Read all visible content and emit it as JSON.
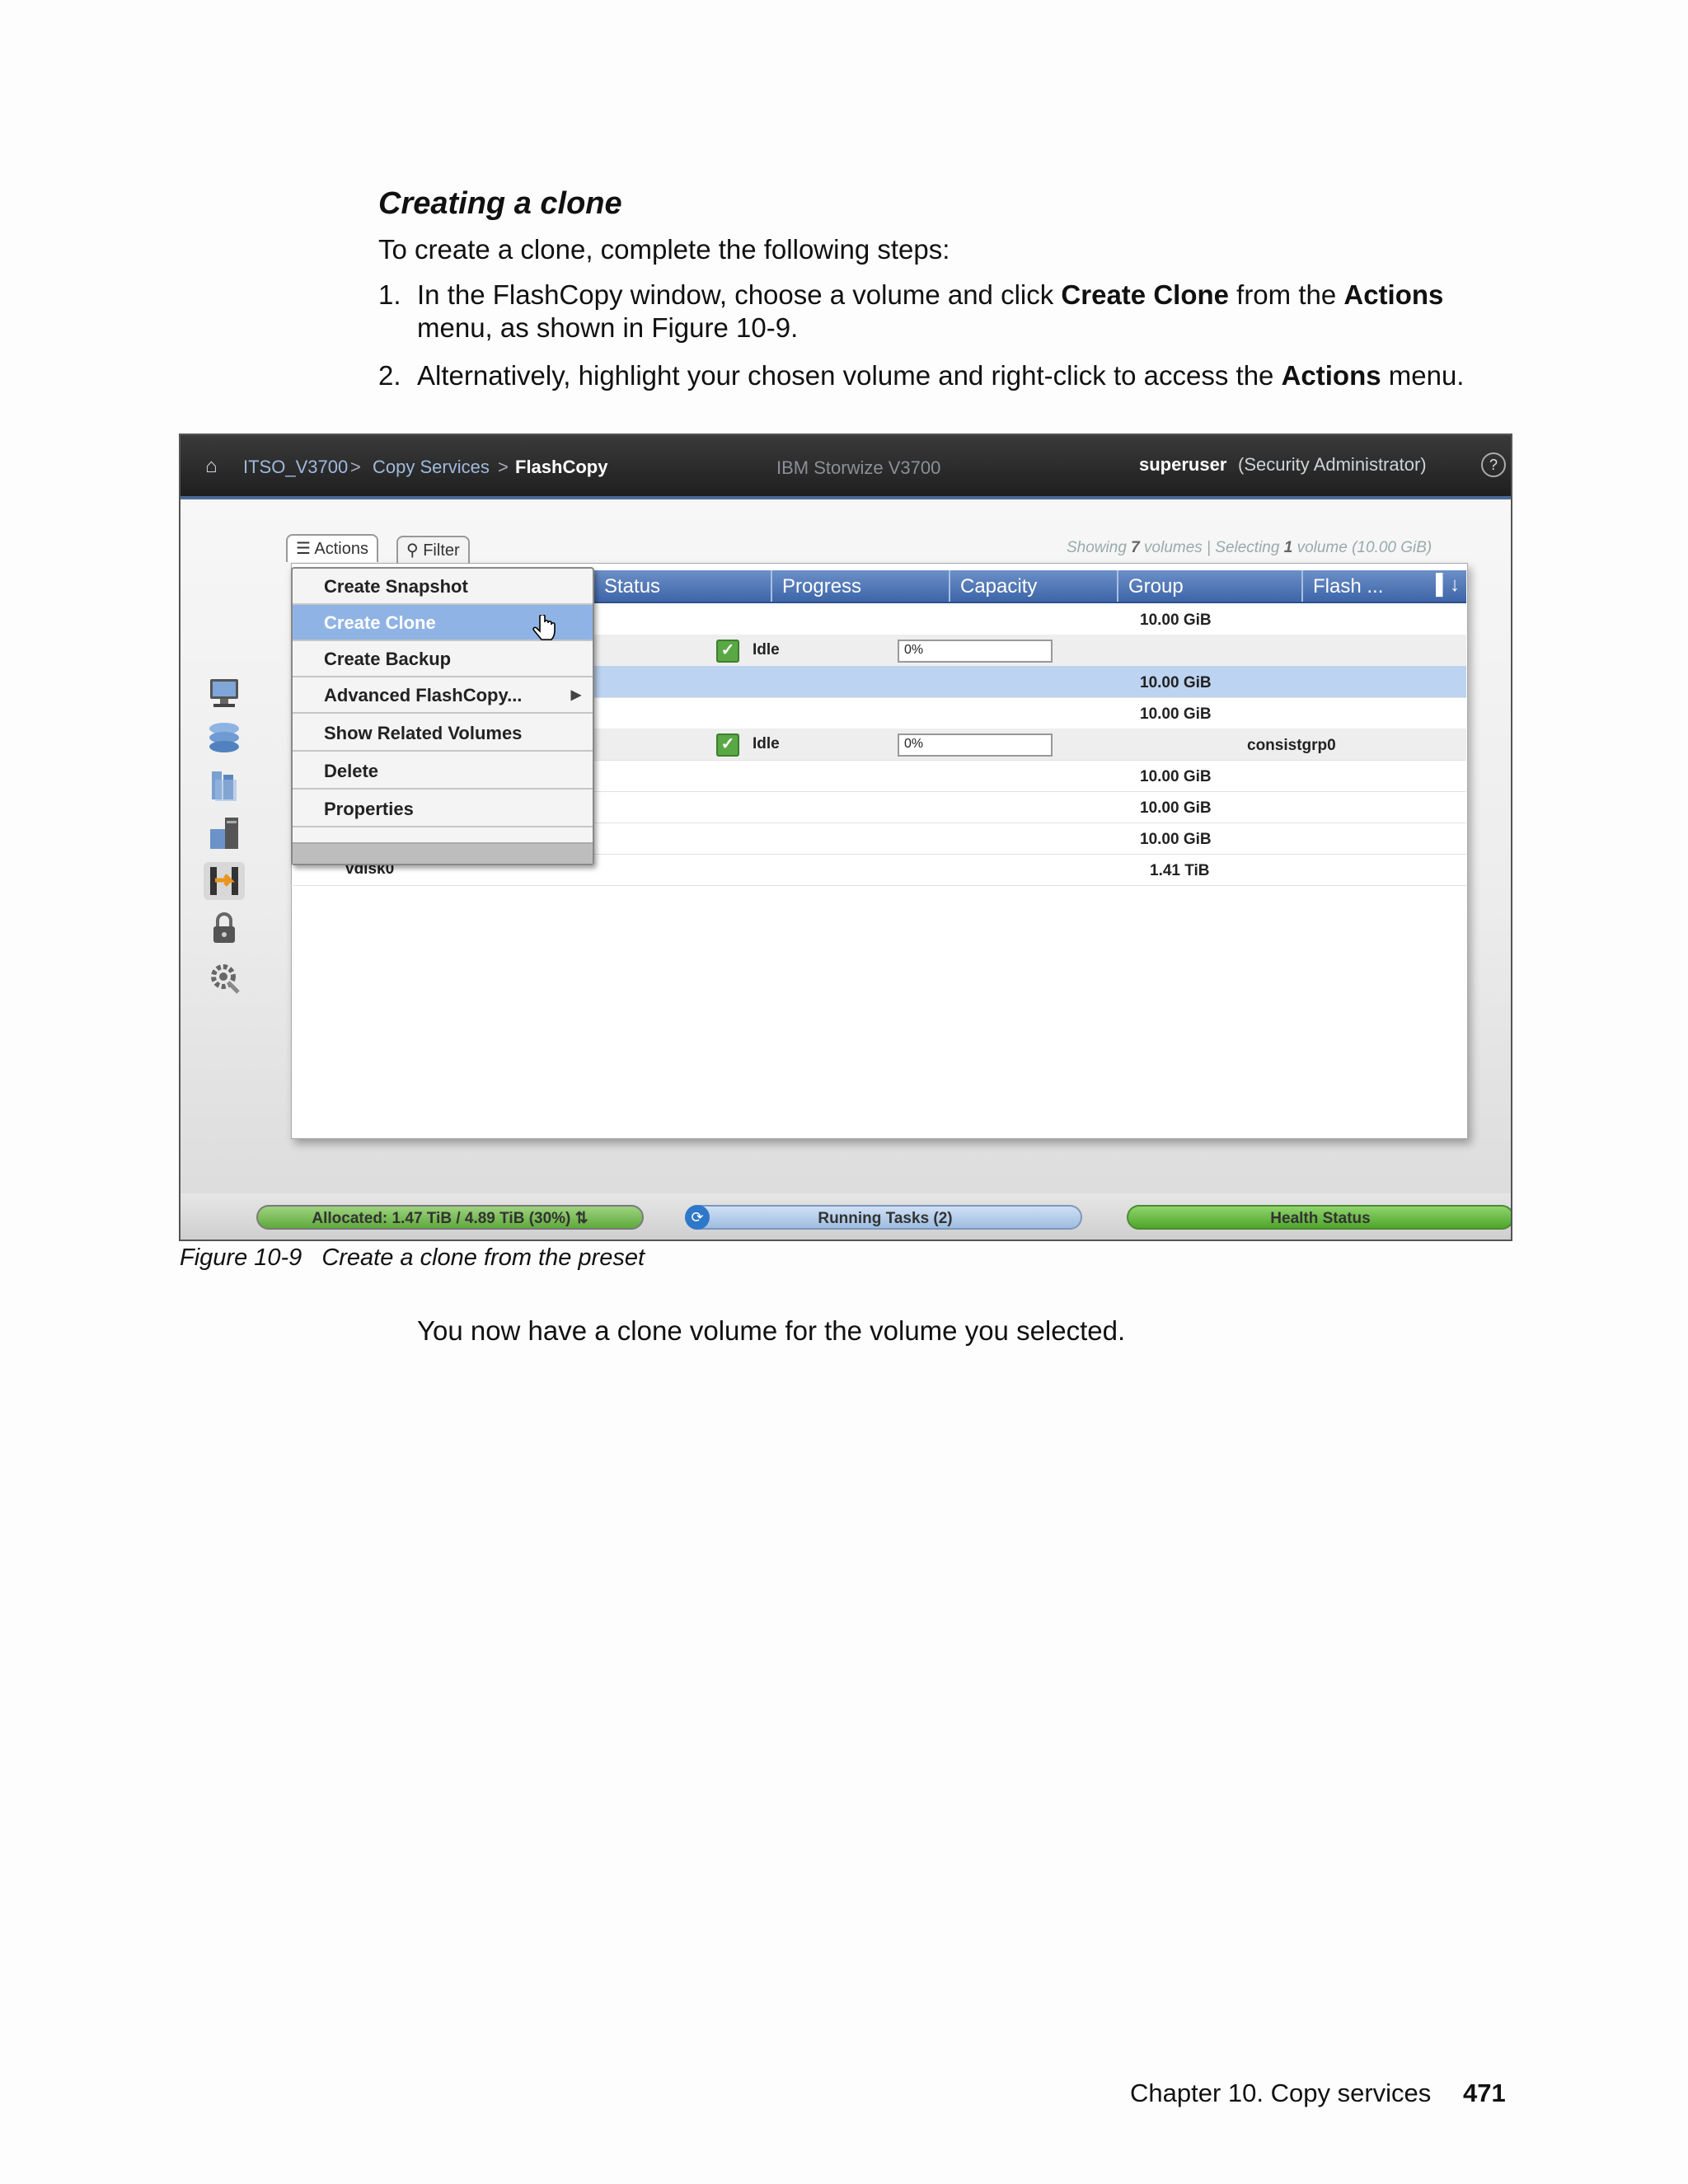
{
  "document": {
    "heading": "Creating a clone",
    "intro": "To create a clone, complete the following steps:",
    "steps": [
      {
        "num": "1.",
        "pre": "In the FlashCopy window, choose a volume and click ",
        "b1": "Create Clone",
        "mid": " from the ",
        "b2": "Actions",
        "post": "",
        "line2": "menu, as shown in Figure 10-9."
      },
      {
        "num": "2.",
        "pre": "Alternatively, highlight your chosen volume and right-click to access the ",
        "b1": "Actions",
        "post": " menu."
      }
    ],
    "figure_number": "Figure 10-9",
    "figure_title": "Create a clone from the preset",
    "after_text": "You now have a clone volume for the volume you selected.",
    "footer_chapter": "Chapter 10. Copy services",
    "footer_page": "471"
  },
  "app": {
    "breadcrumb": [
      "ITSO_V3700",
      "Copy Services",
      "FlashCopy"
    ],
    "product": "IBM Storwize V3700",
    "user": "superuser",
    "role": "(Security Administrator)",
    "help": "?",
    "tabs": {
      "actions": "Actions",
      "filter": "Filter"
    },
    "showing": {
      "pre": "Showing ",
      "n1": "7",
      "mid": " volumes | Selecting ",
      "n2": "1",
      "post": " volume (10.00 GiB)"
    },
    "columns": [
      "Status",
      "Progress",
      "Capacity",
      "Group",
      "Flash ..."
    ],
    "rows": [
      {
        "capacity": "10.00 GiB"
      },
      {
        "status": "Idle",
        "progress": "0%",
        "progress_value": 0
      },
      {
        "capacity": "10.00 GiB",
        "selected": true
      },
      {
        "capacity": "10.00 GiB"
      },
      {
        "status": "Idle",
        "progress": "0%",
        "progress_value": 0,
        "group": "consistgrp0"
      },
      {
        "capacity": "10.00 GiB"
      },
      {
        "capacity": "10.00 GiB"
      },
      {
        "capacity": "10.00 GiB"
      },
      {
        "name": "vdisk0",
        "capacity": "1.41 TiB"
      }
    ],
    "menu": [
      "Create Snapshot",
      "Create Clone",
      "Create Backup",
      "Advanced FlashCopy...",
      "Show Related Volumes",
      "Delete",
      "Properties"
    ],
    "menu_highlighted": "Create Clone",
    "status": {
      "allocated": "Allocated: 1.47 TiB / 4.89 TiB (30%)",
      "tasks": "Running Tasks (2)",
      "health": "Health Status"
    },
    "nav_icons": [
      "monitoring-icon",
      "pools-icon",
      "volumes-icon",
      "hosts-icon",
      "copy-services-icon",
      "access-icon",
      "settings-icon"
    ]
  }
}
